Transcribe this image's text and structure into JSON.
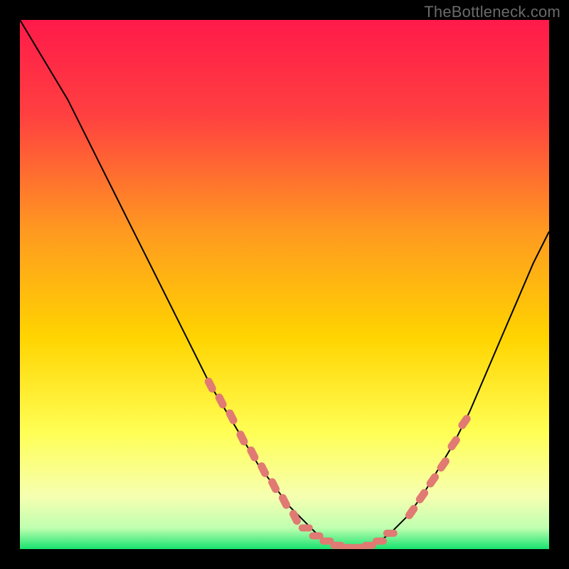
{
  "watermark": "TheBottleneck.com",
  "colors": {
    "frame": "#000000",
    "watermark": "#6a6a6a",
    "gradient_top": "#ff1a4a",
    "gradient_mid1": "#ff7a2a",
    "gradient_mid2": "#ffd400",
    "gradient_mid3": "#ffff55",
    "gradient_low": "#f6ffb0",
    "gradient_bottom": "#17e36f",
    "curve": "#000000",
    "marker": "#e07a72"
  },
  "chart_data": {
    "type": "line",
    "title": "",
    "xlabel": "",
    "ylabel": "",
    "xlim": [
      0,
      100
    ],
    "ylim": [
      0,
      100
    ],
    "series": [
      {
        "name": "bottleneck-curve",
        "x": [
          0,
          3,
          6,
          9,
          12,
          15,
          18,
          21,
          24,
          27,
          30,
          33,
          36,
          39,
          42,
          45,
          48,
          51,
          54,
          56,
          58,
          60,
          62,
          64,
          66,
          68,
          70,
          73,
          76,
          79,
          82,
          85,
          88,
          91,
          94,
          97,
          100
        ],
        "y": [
          100,
          95,
          90,
          85,
          79,
          73,
          67,
          61,
          55,
          49,
          43,
          37,
          31,
          26,
          21,
          16,
          12,
          8,
          5,
          3,
          1.5,
          0.7,
          0.3,
          0.3,
          0.7,
          1.5,
          3,
          6,
          10,
          15,
          20,
          26,
          33,
          40,
          47,
          54,
          60
        ]
      }
    ],
    "markers_left": {
      "x": [
        36,
        38,
        40,
        42,
        44,
        46,
        48,
        50,
        52
      ],
      "y": [
        31,
        28,
        25,
        21,
        18,
        15,
        12,
        9,
        6
      ]
    },
    "markers_bottom": {
      "x": [
        54,
        56,
        58,
        60,
        62,
        64,
        66,
        68,
        70
      ],
      "y": [
        4,
        2.5,
        1.5,
        0.7,
        0.3,
        0.3,
        0.7,
        1.5,
        3
      ]
    },
    "markers_right": {
      "x": [
        74,
        76,
        78,
        80,
        82,
        84
      ],
      "y": [
        7,
        10,
        13,
        16,
        20,
        24
      ]
    }
  }
}
